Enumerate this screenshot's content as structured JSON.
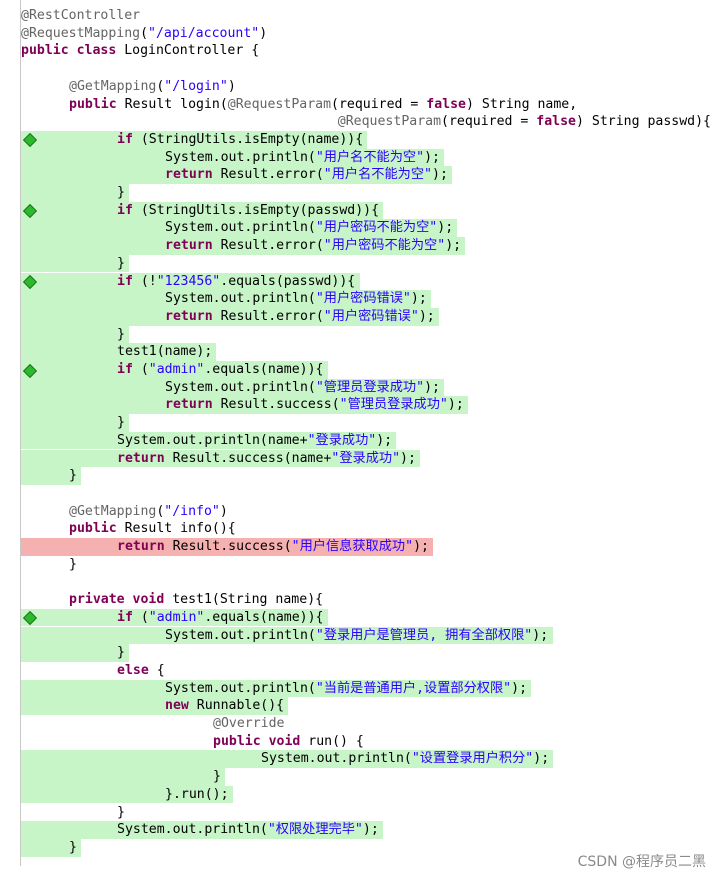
{
  "editor": {
    "lines": [
      {
        "indent": 0,
        "tokens": [
          [
            "ann",
            "@RestController"
          ]
        ],
        "hl": null,
        "marker": false
      },
      {
        "indent": 0,
        "tokens": [
          [
            "ann",
            "@RequestMapping"
          ],
          [
            "",
            "("
          ],
          [
            "str",
            "\"/api/account\""
          ],
          [
            "",
            ")"
          ]
        ],
        "hl": null,
        "marker": false
      },
      {
        "indent": 0,
        "tokens": [
          [
            "kw",
            "public class "
          ],
          [
            "",
            "LoginController {"
          ]
        ],
        "hl": null,
        "marker": false
      },
      {
        "indent": 0,
        "tokens": [],
        "hl": null,
        "marker": false
      },
      {
        "indent": 1,
        "tokens": [
          [
            "ann",
            "@GetMapping"
          ],
          [
            "",
            "("
          ],
          [
            "str",
            "\"/login\""
          ],
          [
            "",
            ")"
          ]
        ],
        "hl": null,
        "marker": false
      },
      {
        "indent": 1,
        "tokens": [
          [
            "kw",
            "public "
          ],
          [
            "",
            "Result login("
          ],
          [
            "ann",
            "@RequestParam"
          ],
          [
            "",
            "(required = "
          ],
          [
            "kw",
            "false"
          ],
          [
            "",
            ") String name,"
          ]
        ],
        "hl": null,
        "marker": false
      },
      {
        "indent": 6.6,
        "tokens": [
          [
            "ann",
            "@RequestParam"
          ],
          [
            "",
            "(required = "
          ],
          [
            "kw",
            "false"
          ],
          [
            "",
            ") String passwd){"
          ]
        ],
        "hl": null,
        "marker": false
      },
      {
        "indent": 2,
        "tokens": [
          [
            "kw",
            "if "
          ],
          [
            "",
            "(StringUtils.isEmpty(name)){"
          ]
        ],
        "hl": "green",
        "marker": true
      },
      {
        "indent": 3,
        "tokens": [
          [
            "",
            "System.out.println("
          ],
          [
            "str",
            "\"用户名不能为空\""
          ],
          [
            "",
            ");"
          ]
        ],
        "hl": "green",
        "marker": false
      },
      {
        "indent": 3,
        "tokens": [
          [
            "kw",
            "return "
          ],
          [
            "",
            "Result.error("
          ],
          [
            "str",
            "\"用户名不能为空\""
          ],
          [
            "",
            ");"
          ]
        ],
        "hl": "green",
        "marker": false
      },
      {
        "indent": 2,
        "tokens": [
          [
            "",
            "}"
          ]
        ],
        "hl": "green",
        "marker": false
      },
      {
        "indent": 2,
        "tokens": [
          [
            "kw",
            "if "
          ],
          [
            "",
            "(StringUtils.isEmpty(passwd)){"
          ]
        ],
        "hl": "green",
        "marker": true
      },
      {
        "indent": 3,
        "tokens": [
          [
            "",
            "System.out.println("
          ],
          [
            "str",
            "\"用户密码不能为空\""
          ],
          [
            "",
            ");"
          ]
        ],
        "hl": "green",
        "marker": false
      },
      {
        "indent": 3,
        "tokens": [
          [
            "kw",
            "return "
          ],
          [
            "",
            "Result.error("
          ],
          [
            "str",
            "\"用户密码不能为空\""
          ],
          [
            "",
            ");"
          ]
        ],
        "hl": "green",
        "marker": false
      },
      {
        "indent": 2,
        "tokens": [
          [
            "",
            "}"
          ]
        ],
        "hl": "green",
        "marker": false
      },
      {
        "indent": 2,
        "tokens": [
          [
            "kw",
            "if "
          ],
          [
            "",
            "(!"
          ],
          [
            "str",
            "\"123456\""
          ],
          [
            "",
            ".equals(passwd)){"
          ]
        ],
        "hl": "green",
        "marker": true
      },
      {
        "indent": 3,
        "tokens": [
          [
            "",
            "System.out.println("
          ],
          [
            "str",
            "\"用户密码错误\""
          ],
          [
            "",
            ");"
          ]
        ],
        "hl": "green",
        "marker": false
      },
      {
        "indent": 3,
        "tokens": [
          [
            "kw",
            "return "
          ],
          [
            "",
            "Result.error("
          ],
          [
            "str",
            "\"用户密码错误\""
          ],
          [
            "",
            ");"
          ]
        ],
        "hl": "green",
        "marker": false
      },
      {
        "indent": 2,
        "tokens": [
          [
            "",
            "}"
          ]
        ],
        "hl": "green",
        "marker": false
      },
      {
        "indent": 2,
        "tokens": [
          [
            "",
            "test1(name);"
          ]
        ],
        "hl": "green",
        "marker": false
      },
      {
        "indent": 2,
        "tokens": [
          [
            "kw",
            "if "
          ],
          [
            "",
            "("
          ],
          [
            "str",
            "\"admin\""
          ],
          [
            "",
            ".equals(name)){"
          ]
        ],
        "hl": "green",
        "marker": true
      },
      {
        "indent": 3,
        "tokens": [
          [
            "",
            "System.out.println("
          ],
          [
            "str",
            "\"管理员登录成功\""
          ],
          [
            "",
            ");"
          ]
        ],
        "hl": "green",
        "marker": false
      },
      {
        "indent": 3,
        "tokens": [
          [
            "kw",
            "return "
          ],
          [
            "",
            "Result.success("
          ],
          [
            "str",
            "\"管理员登录成功\""
          ],
          [
            "",
            ");"
          ]
        ],
        "hl": "green",
        "marker": false
      },
      {
        "indent": 2,
        "tokens": [
          [
            "",
            "}"
          ]
        ],
        "hl": "green",
        "marker": false
      },
      {
        "indent": 2,
        "tokens": [
          [
            "",
            "System.out.println(name+"
          ],
          [
            "str",
            "\"登录成功\""
          ],
          [
            "",
            ");"
          ]
        ],
        "hl": "green",
        "marker": false
      },
      {
        "indent": 2,
        "tokens": [
          [
            "kw",
            "return "
          ],
          [
            "",
            "Result.success(name+"
          ],
          [
            "str",
            "\"登录成功\""
          ],
          [
            "",
            ");"
          ]
        ],
        "hl": "green",
        "marker": false
      },
      {
        "indent": 1,
        "tokens": [
          [
            "",
            "}"
          ]
        ],
        "hl": "green",
        "marker": false
      },
      {
        "indent": 0,
        "tokens": [],
        "hl": null,
        "marker": false
      },
      {
        "indent": 1,
        "tokens": [
          [
            "ann",
            "@GetMapping"
          ],
          [
            "",
            "("
          ],
          [
            "str",
            "\"/info\""
          ],
          [
            "",
            ")"
          ]
        ],
        "hl": null,
        "marker": false
      },
      {
        "indent": 1,
        "tokens": [
          [
            "kw",
            "public "
          ],
          [
            "",
            "Result info(){"
          ]
        ],
        "hl": null,
        "marker": false
      },
      {
        "indent": 2,
        "tokens": [
          [
            "kw",
            "return "
          ],
          [
            "",
            "Result.success("
          ],
          [
            "str",
            "\"用户信息获取成功\""
          ],
          [
            "",
            ");"
          ]
        ],
        "hl": "red",
        "marker": false
      },
      {
        "indent": 1,
        "tokens": [
          [
            "",
            "}"
          ]
        ],
        "hl": null,
        "marker": false
      },
      {
        "indent": 0,
        "tokens": [],
        "hl": null,
        "marker": false
      },
      {
        "indent": 1,
        "tokens": [
          [
            "kw",
            "private void "
          ],
          [
            "",
            "test1(String name){"
          ]
        ],
        "hl": null,
        "marker": false
      },
      {
        "indent": 2,
        "tokens": [
          [
            "kw",
            "if "
          ],
          [
            "",
            "("
          ],
          [
            "str",
            "\"admin\""
          ],
          [
            "",
            ".equals(name)){"
          ]
        ],
        "hl": "green",
        "marker": true
      },
      {
        "indent": 3,
        "tokens": [
          [
            "",
            "System.out.println("
          ],
          [
            "str",
            "\"登录用户是管理员, 拥有全部权限\""
          ],
          [
            "",
            ");"
          ]
        ],
        "hl": "green",
        "marker": false
      },
      {
        "indent": 2,
        "tokens": [
          [
            "",
            "}"
          ]
        ],
        "hl": "green",
        "marker": false
      },
      {
        "indent": 2,
        "tokens": [
          [
            "kw",
            "else "
          ],
          [
            "",
            "{"
          ]
        ],
        "hl": null,
        "marker": false
      },
      {
        "indent": 3,
        "tokens": [
          [
            "",
            "System.out.println("
          ],
          [
            "str",
            "\"当前是普通用户,设置部分权限\""
          ],
          [
            "",
            ");"
          ]
        ],
        "hl": "green",
        "marker": false
      },
      {
        "indent": 3,
        "tokens": [
          [
            "kw",
            "new "
          ],
          [
            "",
            "Runnable(){"
          ]
        ],
        "hl": "green",
        "marker": false
      },
      {
        "indent": 4,
        "tokens": [
          [
            "ann",
            "@Override"
          ]
        ],
        "hl": null,
        "marker": false
      },
      {
        "indent": 4,
        "tokens": [
          [
            "kw",
            "public void "
          ],
          [
            "",
            "run() {"
          ]
        ],
        "hl": null,
        "marker": false
      },
      {
        "indent": 5,
        "tokens": [
          [
            "",
            "System.out.println("
          ],
          [
            "str",
            "\"设置登录用户积分\""
          ],
          [
            "",
            ");"
          ]
        ],
        "hl": "green",
        "marker": false
      },
      {
        "indent": 4,
        "tokens": [
          [
            "",
            "}"
          ]
        ],
        "hl": "green",
        "marker": false
      },
      {
        "indent": 3,
        "tokens": [
          [
            "",
            "}.run();"
          ]
        ],
        "hl": "green",
        "marker": false
      },
      {
        "indent": 2,
        "tokens": [
          [
            "",
            "}"
          ]
        ],
        "hl": null,
        "marker": false
      },
      {
        "indent": 2,
        "tokens": [
          [
            "",
            "System.out.println("
          ],
          [
            "str",
            "\"权限处理完毕\""
          ],
          [
            "",
            ");"
          ]
        ],
        "hl": "green",
        "marker": false
      },
      {
        "indent": 1,
        "tokens": [
          [
            "",
            "}"
          ]
        ],
        "hl": "green",
        "marker": false
      }
    ]
  },
  "watermark": "CSDN @程序员二黑",
  "colors": {
    "covered": "#c8f5c8",
    "uncovered": "#f5b0b0",
    "keyword": "#7f0055",
    "annotation": "#646464",
    "string": "#2a00ff",
    "marker": "#2eb82e"
  },
  "icons": {
    "covered_branch_marker": "green-diamond-icon"
  }
}
